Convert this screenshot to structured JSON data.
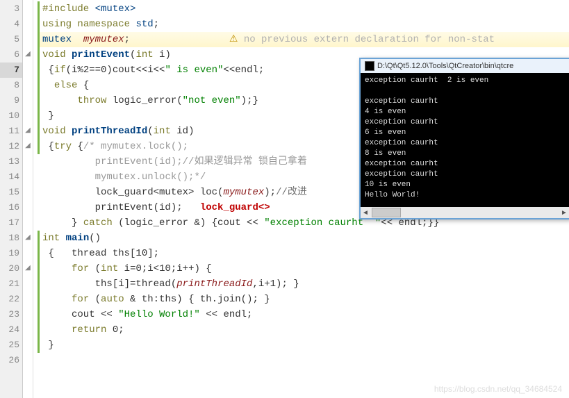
{
  "gutter": {
    "start": 3,
    "end": 26,
    "current": 7
  },
  "fold_at": [
    6,
    11,
    12,
    18,
    20
  ],
  "code_lines": [
    {
      "g": true,
      "tokens": [
        {
          "t": "#include ",
          "c": "kw"
        },
        {
          "t": "<mutex>",
          "c": "ty"
        }
      ]
    },
    {
      "g": true,
      "tokens": [
        {
          "t": "using ",
          "c": "kw"
        },
        {
          "t": "namespace ",
          "c": "kw"
        },
        {
          "t": "std",
          "c": "ty"
        },
        {
          "t": ";",
          "c": "op"
        }
      ]
    },
    {
      "g": true,
      "hl": true,
      "tokens": [
        {
          "t": "mutex  ",
          "c": "ty"
        },
        {
          "t": "mymutex",
          "c": "var"
        },
        {
          "t": ";                 ",
          "c": "op"
        },
        {
          "t": "⚠ ",
          "c": "warn-ic"
        },
        {
          "t": "no previous extern declaration for non-stat",
          "c": "warn"
        }
      ]
    },
    {
      "g": true,
      "tokens": [
        {
          "t": "void ",
          "c": "kw"
        },
        {
          "t": "printEvent",
          "c": "fn"
        },
        {
          "t": "(",
          "c": "op"
        },
        {
          "t": "int",
          "c": "kw"
        },
        {
          "t": " i)",
          "c": "op"
        }
      ]
    },
    {
      "g": true,
      "tokens": [
        {
          "t": " {",
          "c": "op"
        },
        {
          "t": "if",
          "c": "kw"
        },
        {
          "t": "(i%2==0)cout<<i<<",
          "c": "op"
        },
        {
          "t": "\" is even\"",
          "c": "str"
        },
        {
          "t": "<<endl;",
          "c": "op"
        }
      ]
    },
    {
      "g": true,
      "tokens": [
        {
          "t": "  ",
          "c": ""
        },
        {
          "t": "else",
          "c": "kw"
        },
        {
          "t": " {",
          "c": "op"
        }
      ]
    },
    {
      "g": true,
      "tokens": [
        {
          "t": "      ",
          "c": ""
        },
        {
          "t": "throw",
          "c": "kw"
        },
        {
          "t": " logic_error(",
          "c": "op"
        },
        {
          "t": "\"not even\"",
          "c": "str"
        },
        {
          "t": ");}",
          "c": "op"
        }
      ]
    },
    {
      "g": true,
      "tokens": [
        {
          "t": " }",
          "c": "op"
        }
      ]
    },
    {
      "g": true,
      "tokens": [
        {
          "t": "void ",
          "c": "kw"
        },
        {
          "t": "printThreadId",
          "c": "fn"
        },
        {
          "t": "(",
          "c": "op"
        },
        {
          "t": "int",
          "c": "kw"
        },
        {
          "t": " id)",
          "c": "op"
        }
      ]
    },
    {
      "g": true,
      "tokens": [
        {
          "t": " {",
          "c": "op"
        },
        {
          "t": "try",
          "c": "kw"
        },
        {
          "t": " {",
          "c": "op"
        },
        {
          "t": "/* mymutex.lock();",
          "c": "com"
        }
      ]
    },
    {
      "tokens": [
        {
          "t": "         ",
          "c": ""
        },
        {
          "t": "printEvent(id);//如果逻辑异常 锁自己拿着",
          "c": "com"
        }
      ]
    },
    {
      "tokens": [
        {
          "t": "         ",
          "c": ""
        },
        {
          "t": "mymutex.unlock();*/",
          "c": "com"
        }
      ]
    },
    {
      "tokens": [
        {
          "t": "         lock_guard<mutex> loc(",
          "c": "op"
        },
        {
          "t": "mymutex",
          "c": "var"
        },
        {
          "t": ");",
          "c": "op"
        },
        {
          "t": "//改进",
          "c": "comcn"
        }
      ]
    },
    {
      "tokens": [
        {
          "t": "         printEvent(id);   ",
          "c": "op"
        },
        {
          "t": "lock_guard<>",
          "c": "anno"
        }
      ]
    },
    {
      "tokens": [
        {
          "t": "     } ",
          "c": "op"
        },
        {
          "t": "catch",
          "c": "kw"
        },
        {
          "t": " (logic_error &) {cout << ",
          "c": "op"
        },
        {
          "t": "\"exception caurht  \"",
          "c": "str"
        },
        {
          "t": "<< endl;}}",
          "c": "op"
        }
      ]
    },
    {
      "g": true,
      "tokens": [
        {
          "t": "int ",
          "c": "kw"
        },
        {
          "t": "main",
          "c": "fn"
        },
        {
          "t": "()",
          "c": "op"
        }
      ]
    },
    {
      "g": true,
      "tokens": [
        {
          "t": " {   thread ths[10];",
          "c": "op"
        }
      ]
    },
    {
      "g": true,
      "tokens": [
        {
          "t": "     ",
          "c": ""
        },
        {
          "t": "for",
          "c": "kw"
        },
        {
          "t": " (",
          "c": "op"
        },
        {
          "t": "int",
          "c": "kw"
        },
        {
          "t": " i=0;i<10;i++) {",
          "c": "op"
        }
      ]
    },
    {
      "g": true,
      "tokens": [
        {
          "t": "         ths[i]=thread(",
          "c": "op"
        },
        {
          "t": "printThreadId",
          "c": "var"
        },
        {
          "t": ",i+1); }",
          "c": "op"
        }
      ]
    },
    {
      "g": true,
      "tokens": [
        {
          "t": "     ",
          "c": ""
        },
        {
          "t": "for",
          "c": "kw"
        },
        {
          "t": " (",
          "c": "op"
        },
        {
          "t": "auto",
          "c": "kw"
        },
        {
          "t": " & th:ths) { th.join(); }",
          "c": "op"
        }
      ]
    },
    {
      "g": true,
      "tokens": [
        {
          "t": "     cout << ",
          "c": "op"
        },
        {
          "t": "\"Hello World!\"",
          "c": "str"
        },
        {
          "t": " << endl;",
          "c": "op"
        }
      ]
    },
    {
      "g": true,
      "tokens": [
        {
          "t": "     ",
          "c": ""
        },
        {
          "t": "return",
          "c": "kw"
        },
        {
          "t": " 0;",
          "c": "op"
        }
      ]
    },
    {
      "g": true,
      "tokens": [
        {
          "t": " }",
          "c": "op"
        }
      ]
    },
    {
      "tokens": []
    }
  ],
  "console": {
    "title": "D:\\Qt\\Qt5.12.0\\Tools\\QtCreator\\bin\\qtcre",
    "lines": [
      "exception caurht  2 is even",
      "",
      "exception caurht",
      "4 is even",
      "exception caurht",
      "6 is even",
      "exception caurht",
      "8 is even",
      "exception caurht",
      "exception caurht",
      "10 is even",
      "Hello World!"
    ]
  },
  "watermark": "https://blog.csdn.net/qq_34684524"
}
